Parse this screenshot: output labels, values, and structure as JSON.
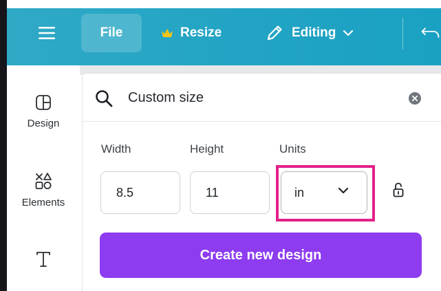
{
  "topbar": {
    "file_label": "File",
    "resize_label": "Resize",
    "editing_label": "Editing",
    "icons": {
      "menu": "hamburger-menu-icon",
      "crown": "crown-icon",
      "pencil": "pencil-icon",
      "chevron": "chevron-down-icon",
      "undo": "undo-icon"
    },
    "crown_color": "#f5c518"
  },
  "sidebar": {
    "items": [
      {
        "label": "Design",
        "icon": "layout-icon"
      },
      {
        "label": "Elements",
        "icon": "shapes-icon"
      },
      {
        "label": "",
        "icon": "text-icon"
      }
    ]
  },
  "panel": {
    "search": {
      "value": "Custom size",
      "icon": "search-icon",
      "clear_icon": "clear-icon"
    },
    "width": {
      "label": "Width",
      "value": "8.5"
    },
    "height": {
      "label": "Height",
      "value": "11"
    },
    "units": {
      "label": "Units",
      "value": "in"
    },
    "lock_icon": "unlocked-icon",
    "create_label": "Create new design"
  },
  "colors": {
    "topbar": "#22a4c4",
    "primary_button": "#8d3cf0",
    "highlight": "#e2218a"
  }
}
